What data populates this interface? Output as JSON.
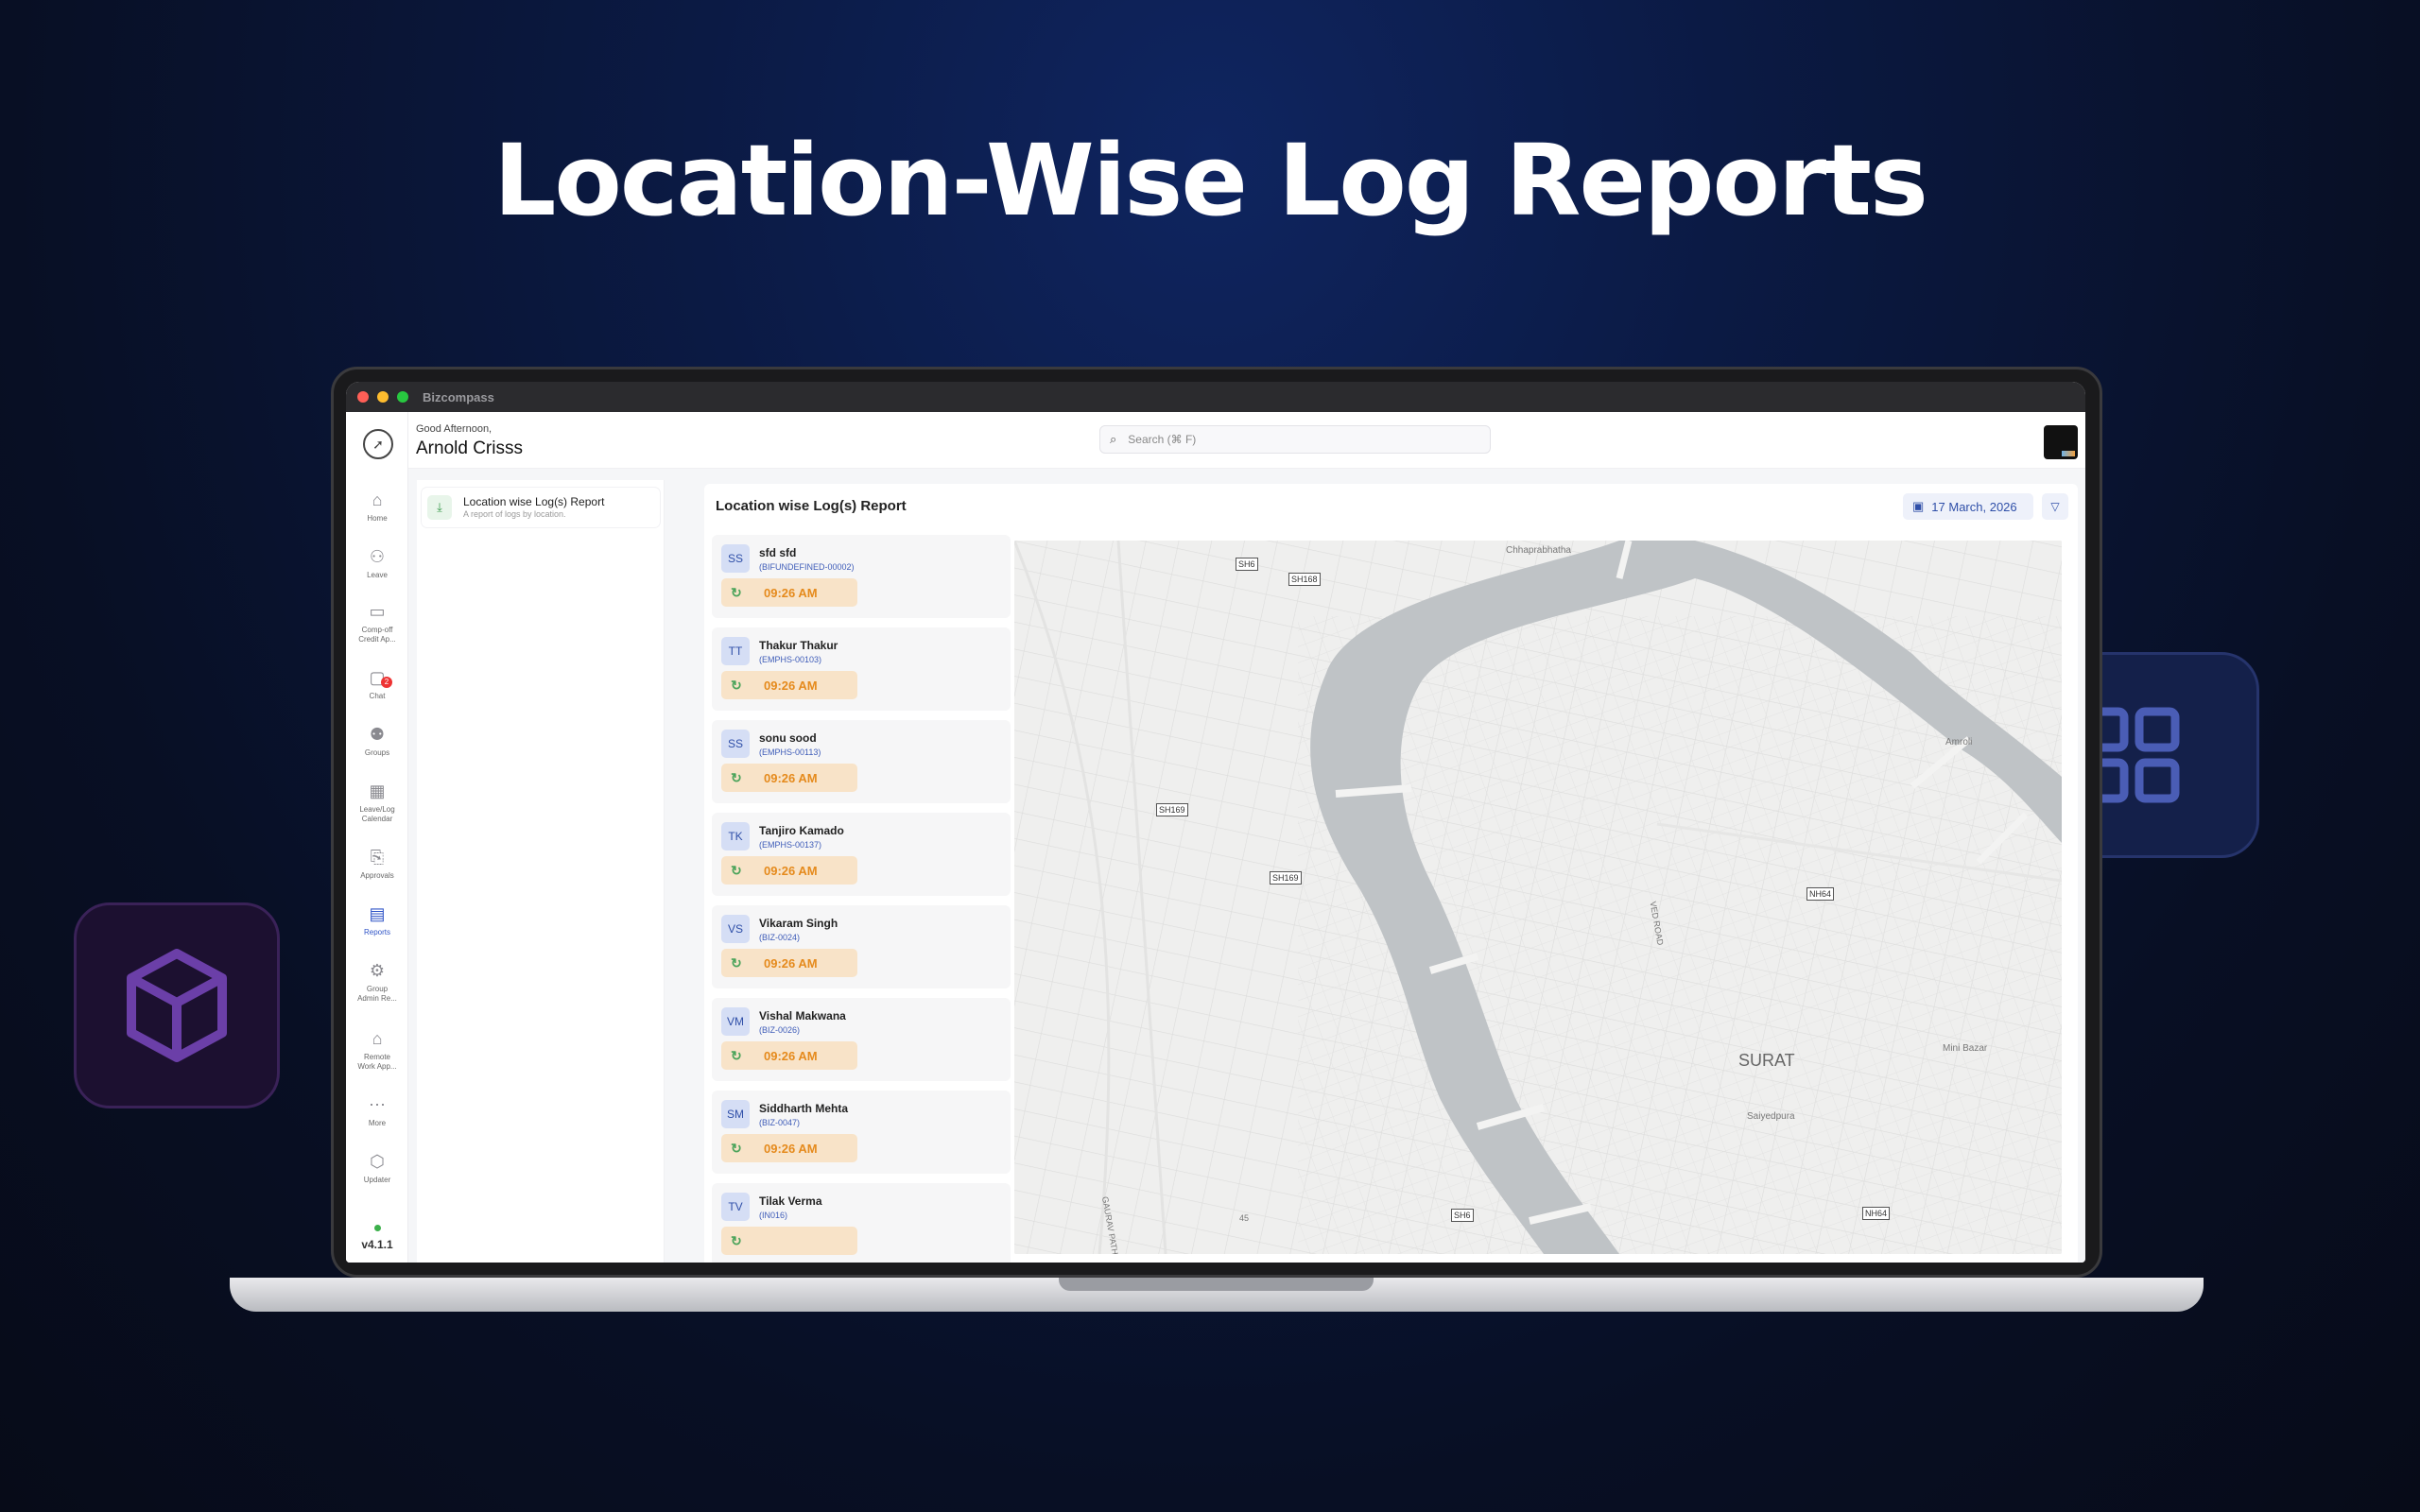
{
  "hero": {
    "title": "Location-Wise Log Reports"
  },
  "window": {
    "title": "Bizcompass"
  },
  "header": {
    "greeting": "Good Afternoon,",
    "user_name": "Arnold Crisss",
    "search_placeholder": "Search (⌘ F)"
  },
  "sidebar": {
    "items": [
      {
        "label": "Home",
        "icon": "home-icon"
      },
      {
        "label": "Leave",
        "icon": "leave-icon"
      },
      {
        "label": "Comp-off\nCredit Ap...",
        "icon": "comp-off-icon"
      },
      {
        "label": "Chat",
        "icon": "chat-icon",
        "badge": "2"
      },
      {
        "label": "Groups",
        "icon": "groups-icon"
      },
      {
        "label": "Leave/Log\nCalendar",
        "icon": "calendar-icon"
      },
      {
        "label": "Approvals",
        "icon": "approvals-icon"
      },
      {
        "label": "Reports",
        "icon": "reports-icon",
        "active": true
      },
      {
        "label": "Group\nAdmin Re...",
        "icon": "group-admin-icon"
      },
      {
        "label": "Remote\nWork App...",
        "icon": "remote-work-icon"
      },
      {
        "label": "More",
        "icon": "more-icon"
      },
      {
        "label": "Updater",
        "icon": "updater-icon"
      }
    ],
    "version": "v4.1.1"
  },
  "reports_panel": {
    "items": [
      {
        "title": "Location wise Log(s) Report",
        "subtitle": "A report of logs by location."
      }
    ]
  },
  "main": {
    "title": "Location wise Log(s) Report",
    "date": "17 March, 2026"
  },
  "logs": [
    {
      "initials": "SS",
      "name": "sfd sfd",
      "code": "(BIFUNDEFINED-00002)",
      "time": "09:26 AM"
    },
    {
      "initials": "TT",
      "name": "Thakur Thakur",
      "code": "(EMPHS-00103)",
      "time": "09:26 AM"
    },
    {
      "initials": "SS",
      "name": "sonu sood",
      "code": "(EMPHS-00113)",
      "time": "09:26 AM"
    },
    {
      "initials": "TK",
      "name": "Tanjiro  Kamado",
      "code": "(EMPHS-00137)",
      "time": "09:26 AM"
    },
    {
      "initials": "VS",
      "name": "Vikaram Singh",
      "code": "(BIZ-0024)",
      "time": "09:26 AM"
    },
    {
      "initials": "VM",
      "name": "Vishal Makwana",
      "code": "(BIZ-0026)",
      "time": "09:26 AM"
    },
    {
      "initials": "SM",
      "name": "Siddharth Mehta",
      "code": "(BIZ-0047)",
      "time": "09:26 AM"
    },
    {
      "initials": "TV",
      "name": "Tilak Verma",
      "code": "(IN016)",
      "time": ""
    }
  ],
  "map": {
    "city": "SURAT",
    "places": [
      "Chhaprabhatha",
      "Amroli",
      "Mini Bazar",
      "Saiyedpura"
    ],
    "roads": [
      "SH6",
      "SH168",
      "SH169",
      "SH169",
      "NH64",
      "NH64",
      "SH6",
      "VED ROAD",
      "GAURAV PATH",
      "45"
    ]
  },
  "colors": {
    "accent": "#2f54c7",
    "time_bg": "#f8e3c8",
    "time_text": "#e58a1c",
    "badge": "#e33333"
  }
}
